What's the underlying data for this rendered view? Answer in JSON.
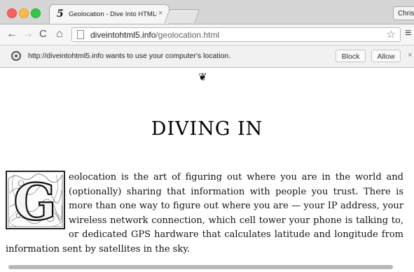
{
  "window": {
    "profile_name": "Chris"
  },
  "tab": {
    "favicon_glyph": "5",
    "title": "Geolocation - Dive Into HTML5",
    "close_glyph": "×"
  },
  "toolbar": {
    "back_glyph": "←",
    "forward_glyph": "→",
    "reload_glyph": "C",
    "home_glyph": "⌂",
    "url_host": "diveintohtml5.info",
    "url_path": "/geolocation.html",
    "star_glyph": "☆",
    "menu_glyph": "≡"
  },
  "infobar": {
    "message": "http://diveintohtml5.info wants to use your computer's location.",
    "block_label": "Block",
    "allow_label": "Allow",
    "close_glyph": "×"
  },
  "page": {
    "ornament": "❦",
    "heading": "DIVING IN",
    "dropcap_letter": "G",
    "paragraph": "eolocation is the art of figuring out where you are in the world and (optionally) sharing that information with people you trust. There is more than one way to figure out where you are — your IP address, your wireless network connection, which cell tower your phone is talking to, or dedicated GPS hardware that calculates latitude and longitude from information sent by satellites in the sky."
  },
  "icons": {
    "page": "page-icon",
    "location": "location-target-icon"
  }
}
